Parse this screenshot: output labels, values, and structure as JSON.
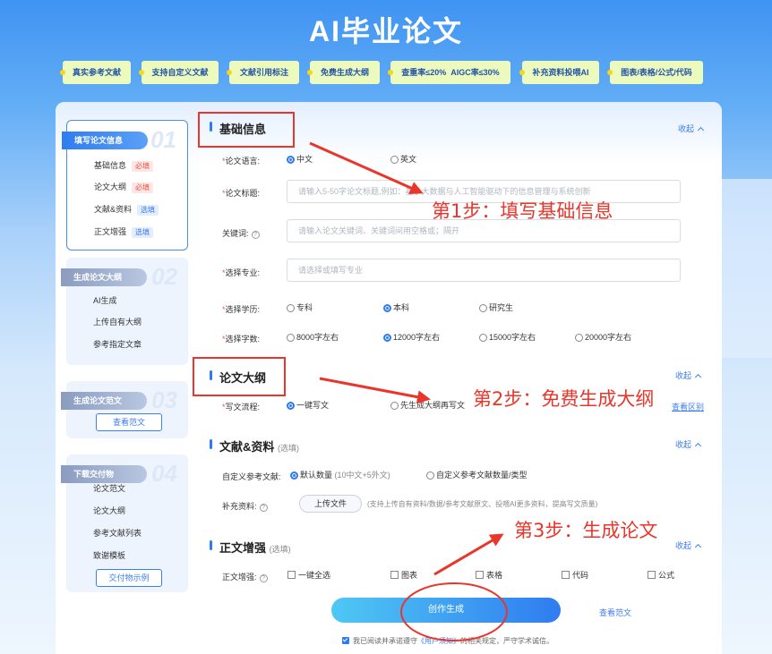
{
  "page_title": "AI毕业论文",
  "features": [
    "真实参考文献",
    "支持自定义文献",
    "文献引用标注",
    "免费生成大纲",
    "查重率≤20%  AIGC率≤30%",
    "补充资料投喂AI",
    "图表/表格/公式/代码"
  ],
  "steps": [
    {
      "num": "01",
      "label": "填写论文信息",
      "items": [
        {
          "label": "基础信息",
          "tag": "必填"
        },
        {
          "label": "论文大纲",
          "tag": "必填"
        },
        {
          "label": "文献&资料",
          "tag": "选填"
        },
        {
          "label": "正文增强",
          "tag": "选填"
        }
      ]
    },
    {
      "num": "02",
      "label": "生成论文大纲",
      "items": [
        {
          "label": "AI生成"
        },
        {
          "label": "上传自有大纲"
        },
        {
          "label": "参考指定文章"
        }
      ]
    },
    {
      "num": "03",
      "label": "生成论文范文",
      "button": "查看范文"
    },
    {
      "num": "04",
      "label": "下载交付物",
      "items": [
        {
          "label": "论文范文"
        },
        {
          "label": "论文大纲"
        },
        {
          "label": "参考文献列表"
        },
        {
          "label": "致谢模板"
        }
      ],
      "button": "交付物示例"
    }
  ],
  "fold_label": "收起",
  "sections": {
    "basic": {
      "title": "基础信息",
      "language": {
        "label": "论文语言:",
        "options": [
          "中文",
          "英文"
        ],
        "selected": 0
      },
      "thesis_title": {
        "label": "论文标题:",
        "placeholder": "请输入5-50字论文标题,例如：基于大数据与人工智能驱动下的信息管理与系统创新"
      },
      "keywords": {
        "label": "关键词:",
        "placeholder": "请输入论文关键词、关键词间用空格或；隔开"
      },
      "major": {
        "label": "选择专业:",
        "placeholder": "请选择或填写专业"
      },
      "degree": {
        "label": "选择学历:",
        "options": [
          "专科",
          "本科",
          "研究生"
        ],
        "selected": 1
      },
      "wordcount": {
        "label": "选择字数:",
        "options": [
          "8000字左右",
          "12000字左右",
          "15000字左右",
          "20000字左右"
        ],
        "selected": 1
      }
    },
    "outline": {
      "title": "论文大纲",
      "flow": {
        "label": "写文流程:",
        "options": [
          "一键写文",
          "先生成大纲再写文"
        ],
        "selected": 0
      },
      "diff_link": "查看区别"
    },
    "refs": {
      "title": "文献&资料",
      "optional": "(选填)",
      "custom": {
        "label": "自定义参考文献:",
        "options": [
          "默认数量",
          "自定义参考文献数量/类型"
        ],
        "default_note": "(10中文+5外文)",
        "selected": 0
      },
      "supplement": {
        "label": "补充资料:",
        "button": "上传文件",
        "hint": "(支持上传自有资料/数据/参考文献原文、投喂AI更多资料，提高写文质量)"
      }
    },
    "enhance": {
      "title": "正文增强",
      "optional": "(选填)",
      "label": "正文增强:",
      "options": [
        "一键全选",
        "图表",
        "表格",
        "代码",
        "公式"
      ]
    }
  },
  "submit_label": "创作生成",
  "view_sample_link": "查看范文",
  "agreement": {
    "prefix": "我已阅读并承诺遵守",
    "link": "《用户须知》",
    "suffix": "的相关规定，严守学术诚信。"
  },
  "annotations": [
    "第1步：填写基础信息",
    "第2步：免费生成大纲",
    "第3步：生成论文"
  ],
  "colors": {
    "accent": "#2f7cf0",
    "annotation": "#e9352a",
    "feature_bg": "#ecfbbd"
  }
}
